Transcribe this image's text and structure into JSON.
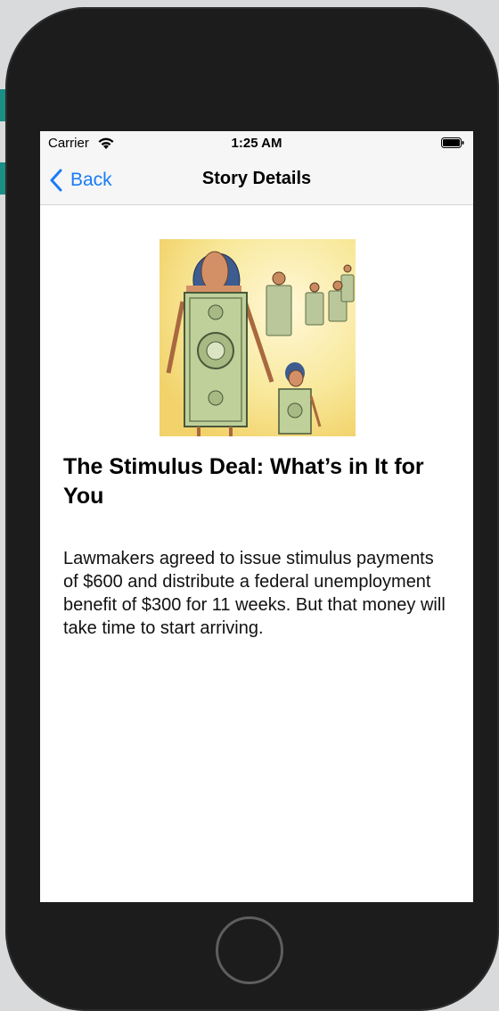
{
  "status_bar": {
    "carrier": "Carrier",
    "time": "1:25 AM",
    "wifi_icon": "wifi-icon",
    "battery_icon": "battery-icon"
  },
  "nav": {
    "back_label": "Back",
    "title": "Story Details",
    "back_icon": "chevron-left-icon",
    "accent_color": "#1a7cf5"
  },
  "story": {
    "headline": "The Stimulus Deal: What’s in It for You",
    "summary": "Lawmakers agreed to issue stimulus payments of $600 and distribute a federal unemployment benefit of $300 for 11 weeks. But that money will take time to start arriving."
  }
}
